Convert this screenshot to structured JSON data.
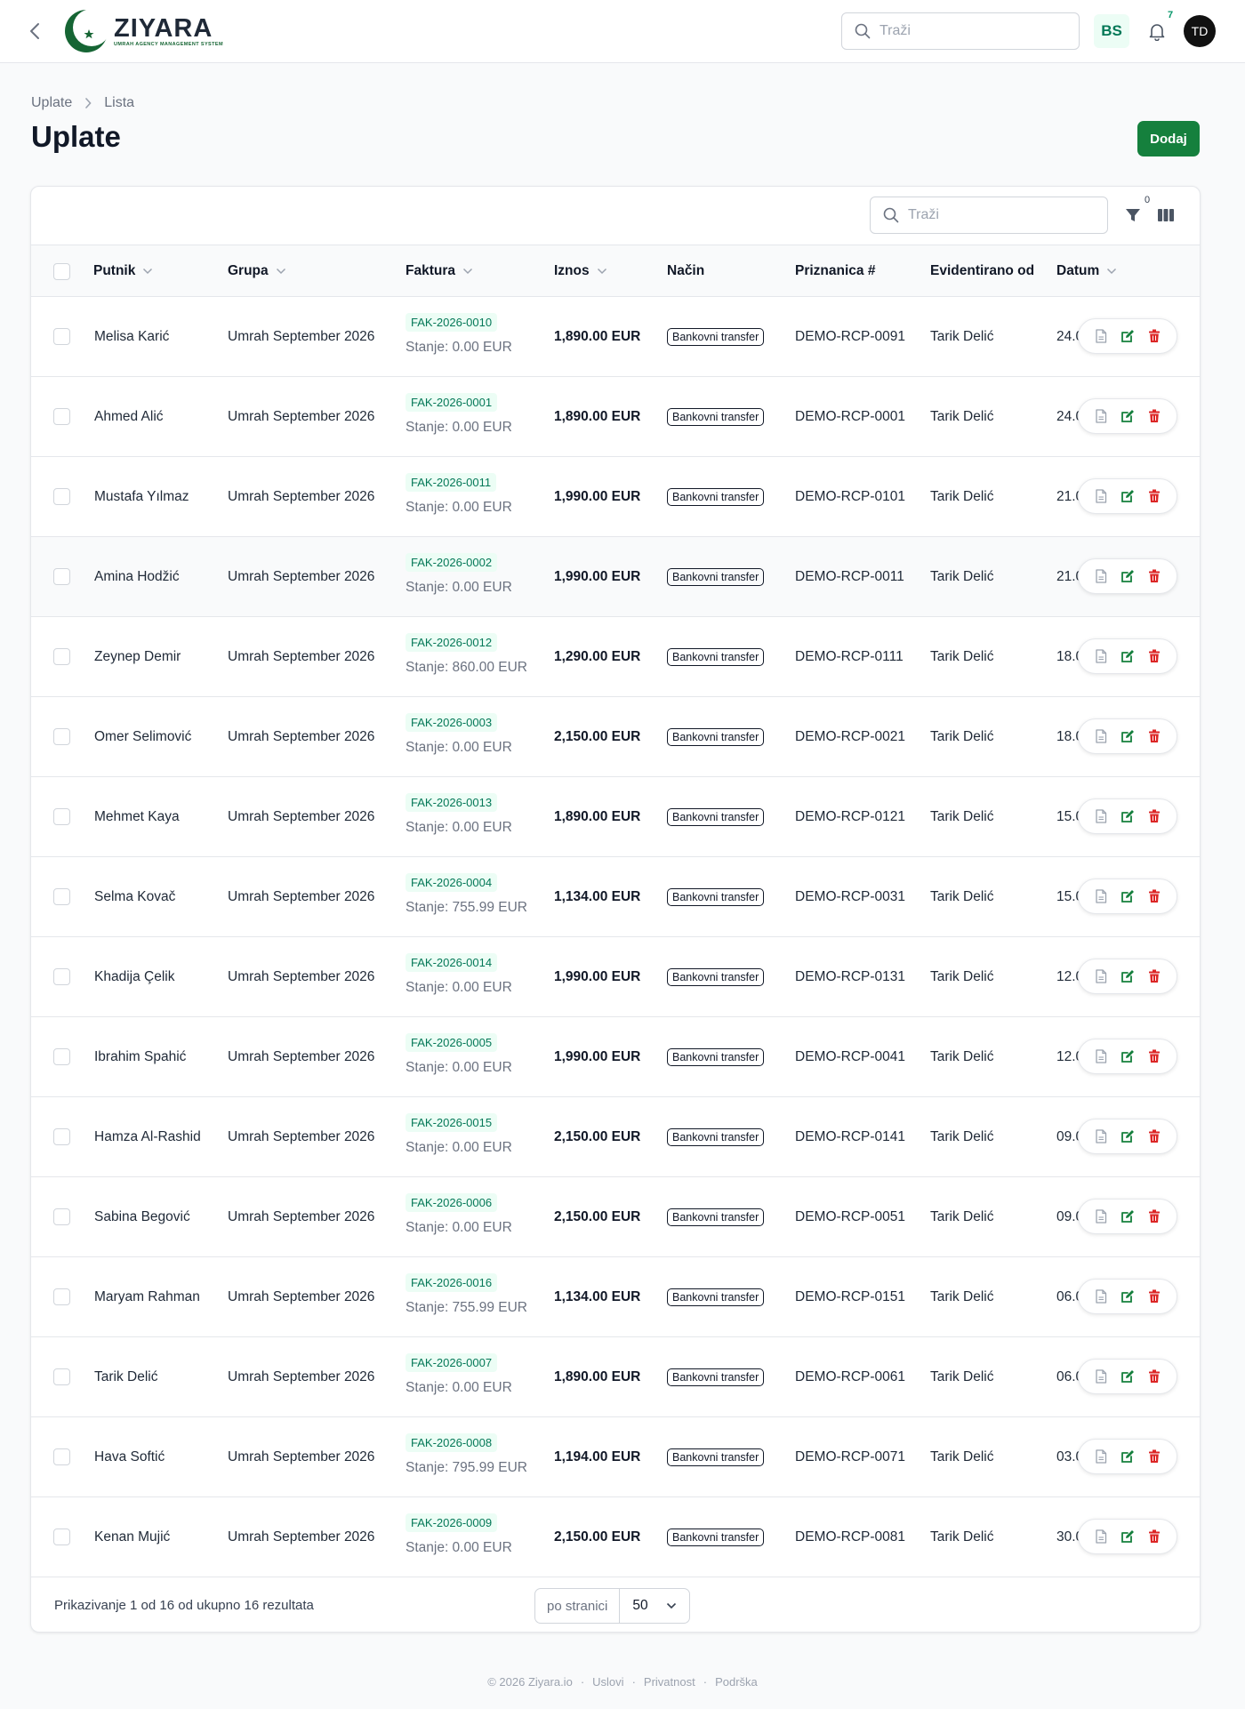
{
  "app": {
    "logo_name": "ZIYARA",
    "logo_tagline": "UMRAH AGENCY MANAGEMENT SYSTEM",
    "accent_color": "#15803d"
  },
  "topbar": {
    "search_placeholder": "Traži",
    "language": "BS",
    "notification_count": "7",
    "avatar_initials": "TD"
  },
  "breadcrumb": {
    "root": "Uplate",
    "current": "Lista"
  },
  "page": {
    "title": "Uplate",
    "add_label": "Dodaj"
  },
  "table": {
    "search_placeholder": "Traži",
    "filter_count": "0",
    "columns": {
      "putnik": "Putnik",
      "grupa": "Grupa",
      "faktura": "Faktura",
      "iznos": "Iznos",
      "nacin": "Način",
      "priznanica": "Priznanica #",
      "evidentirano": "Evidentirano od",
      "datum": "Datum"
    },
    "rows": [
      {
        "putnik": "Melisa Karić",
        "grupa": "Umrah September 2026",
        "faktura": "FAK-2026-0010",
        "stanje": "Stanje: 0.00 EUR",
        "iznos": "1,890.00 EUR",
        "nacin": "Bankovni transfer",
        "priznanica": "DEMO-RCP-0091",
        "evidentirano": "Tarik Delić",
        "datum": "24.0"
      },
      {
        "putnik": "Ahmed Alić",
        "grupa": "Umrah September 2026",
        "faktura": "FAK-2026-0001",
        "stanje": "Stanje: 0.00 EUR",
        "iznos": "1,890.00 EUR",
        "nacin": "Bankovni transfer",
        "priznanica": "DEMO-RCP-0001",
        "evidentirano": "Tarik Delić",
        "datum": "24.0"
      },
      {
        "putnik": "Mustafa Yılmaz",
        "grupa": "Umrah September 2026",
        "faktura": "FAK-2026-0011",
        "stanje": "Stanje: 0.00 EUR",
        "iznos": "1,990.00 EUR",
        "nacin": "Bankovni transfer",
        "priznanica": "DEMO-RCP-0101",
        "evidentirano": "Tarik Delić",
        "datum": "21.0"
      },
      {
        "putnik": "Amina Hodžić",
        "grupa": "Umrah September 2026",
        "faktura": "FAK-2026-0002",
        "stanje": "Stanje: 0.00 EUR",
        "iznos": "1,990.00 EUR",
        "nacin": "Bankovni transfer",
        "priznanica": "DEMO-RCP-0011",
        "evidentirano": "Tarik Delić",
        "datum": "21.0"
      },
      {
        "putnik": "Zeynep Demir",
        "grupa": "Umrah September 2026",
        "faktura": "FAK-2026-0012",
        "stanje": "Stanje: 860.00 EUR",
        "iznos": "1,290.00 EUR",
        "nacin": "Bankovni transfer",
        "priznanica": "DEMO-RCP-0111",
        "evidentirano": "Tarik Delić",
        "datum": "18.0"
      },
      {
        "putnik": "Omer Selimović",
        "grupa": "Umrah September 2026",
        "faktura": "FAK-2026-0003",
        "stanje": "Stanje: 0.00 EUR",
        "iznos": "2,150.00 EUR",
        "nacin": "Bankovni transfer",
        "priznanica": "DEMO-RCP-0021",
        "evidentirano": "Tarik Delić",
        "datum": "18.0"
      },
      {
        "putnik": "Mehmet Kaya",
        "grupa": "Umrah September 2026",
        "faktura": "FAK-2026-0013",
        "stanje": "Stanje: 0.00 EUR",
        "iznos": "1,890.00 EUR",
        "nacin": "Bankovni transfer",
        "priznanica": "DEMO-RCP-0121",
        "evidentirano": "Tarik Delić",
        "datum": "15.0"
      },
      {
        "putnik": "Selma Kovač",
        "grupa": "Umrah September 2026",
        "faktura": "FAK-2026-0004",
        "stanje": "Stanje: 755.99 EUR",
        "iznos": "1,134.00 EUR",
        "nacin": "Bankovni transfer",
        "priznanica": "DEMO-RCP-0031",
        "evidentirano": "Tarik Delić",
        "datum": "15.0"
      },
      {
        "putnik": "Khadija Çelik",
        "grupa": "Umrah September 2026",
        "faktura": "FAK-2026-0014",
        "stanje": "Stanje: 0.00 EUR",
        "iznos": "1,990.00 EUR",
        "nacin": "Bankovni transfer",
        "priznanica": "DEMO-RCP-0131",
        "evidentirano": "Tarik Delić",
        "datum": "12.0"
      },
      {
        "putnik": "Ibrahim Spahić",
        "grupa": "Umrah September 2026",
        "faktura": "FAK-2026-0005",
        "stanje": "Stanje: 0.00 EUR",
        "iznos": "1,990.00 EUR",
        "nacin": "Bankovni transfer",
        "priznanica": "DEMO-RCP-0041",
        "evidentirano": "Tarik Delić",
        "datum": "12.0"
      },
      {
        "putnik": "Hamza Al-Rashid",
        "grupa": "Umrah September 2026",
        "faktura": "FAK-2026-0015",
        "stanje": "Stanje: 0.00 EUR",
        "iznos": "2,150.00 EUR",
        "nacin": "Bankovni transfer",
        "priznanica": "DEMO-RCP-0141",
        "evidentirano": "Tarik Delić",
        "datum": "09.0"
      },
      {
        "putnik": "Sabina Begović",
        "grupa": "Umrah September 2026",
        "faktura": "FAK-2026-0006",
        "stanje": "Stanje: 0.00 EUR",
        "iznos": "2,150.00 EUR",
        "nacin": "Bankovni transfer",
        "priznanica": "DEMO-RCP-0051",
        "evidentirano": "Tarik Delić",
        "datum": "09.0"
      },
      {
        "putnik": "Maryam Rahman",
        "grupa": "Umrah September 2026",
        "faktura": "FAK-2026-0016",
        "stanje": "Stanje: 755.99 EUR",
        "iznos": "1,134.00 EUR",
        "nacin": "Bankovni transfer",
        "priznanica": "DEMO-RCP-0151",
        "evidentirano": "Tarik Delić",
        "datum": "06.0"
      },
      {
        "putnik": "Tarik Delić",
        "grupa": "Umrah September 2026",
        "faktura": "FAK-2026-0007",
        "stanje": "Stanje: 0.00 EUR",
        "iznos": "1,890.00 EUR",
        "nacin": "Bankovni transfer",
        "priznanica": "DEMO-RCP-0061",
        "evidentirano": "Tarik Delić",
        "datum": "06.0"
      },
      {
        "putnik": "Hava Softić",
        "grupa": "Umrah September 2026",
        "faktura": "FAK-2026-0008",
        "stanje": "Stanje: 795.99 EUR",
        "iznos": "1,194.00 EUR",
        "nacin": "Bankovni transfer",
        "priznanica": "DEMO-RCP-0071",
        "evidentirano": "Tarik Delić",
        "datum": "03.0"
      },
      {
        "putnik": "Kenan Mujić",
        "grupa": "Umrah September 2026",
        "faktura": "FAK-2026-0009",
        "stanje": "Stanje: 0.00 EUR",
        "iznos": "2,150.00 EUR",
        "nacin": "Bankovni transfer",
        "priznanica": "DEMO-RCP-0081",
        "evidentirano": "Tarik Delić",
        "datum": "30.0"
      }
    ],
    "hover_row": 3,
    "results_text": "Prikazivanje 1 od 16 od ukupno 16 rezultata",
    "per_page_label": "po stranici",
    "per_page_value": "50"
  },
  "footer": {
    "copyright": "© 2026 Ziyara.io",
    "terms": "Uslovi",
    "privacy": "Privatnost",
    "support": "Podrška"
  }
}
